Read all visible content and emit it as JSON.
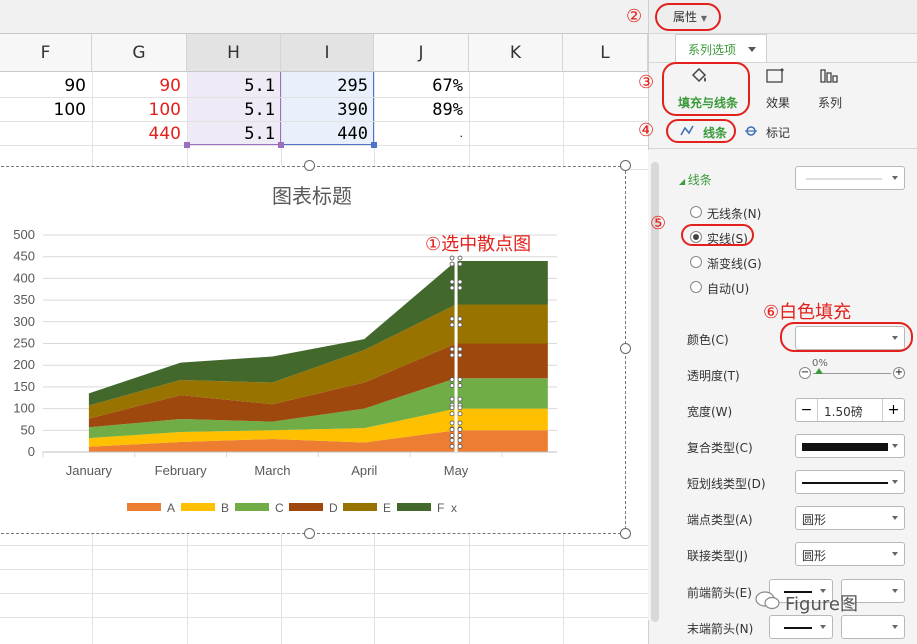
{
  "columns": [
    "F",
    "G",
    "H",
    "I",
    "J",
    "K",
    "L"
  ],
  "rows": [
    {
      "F": "90",
      "G": "90",
      "H": "5.1",
      "I": "295",
      "J": "67%"
    },
    {
      "F": "100",
      "G": "100",
      "H": "5.1",
      "I": "390",
      "J": "89%"
    },
    {
      "F": "",
      "G": "440",
      "H": "5.1",
      "I": "440",
      "J": "."
    }
  ],
  "chart_data": {
    "type": "area",
    "title": "图表标题",
    "x": [
      "January",
      "February",
      "March",
      "April",
      "May"
    ],
    "ylim": [
      0,
      500
    ],
    "yticks": [
      "500",
      "450",
      "400",
      "350",
      "300",
      "250",
      "200",
      "150",
      "100",
      "50",
      "0"
    ],
    "series": [
      {
        "name": "A",
        "color": "#ed7d31",
        "values": [
          12,
          23,
          30,
          22,
          50
        ]
      },
      {
        "name": "B",
        "color": "#ffc000",
        "values": [
          20,
          23,
          20,
          33,
          50
        ]
      },
      {
        "name": "C",
        "color": "#70ad47",
        "values": [
          25,
          30,
          20,
          45,
          70
        ]
      },
      {
        "name": "D",
        "color": "#9e480e",
        "values": [
          20,
          55,
          40,
          60,
          80
        ]
      },
      {
        "name": "E",
        "color": "#997300",
        "values": [
          30,
          35,
          50,
          75,
          90
        ]
      },
      {
        "name": "F",
        "color": "#43682b",
        "values": [
          28,
          40,
          60,
          25,
          100
        ]
      }
    ],
    "legend": [
      "A",
      "B",
      "C",
      "D",
      "E",
      "F",
      "x"
    ],
    "legend_position": "bottom",
    "grid": true
  },
  "annotations": {
    "a1": "①选中散点图",
    "a2": "②",
    "a3": "③",
    "a4": "④",
    "a5": "⑤",
    "a6": "⑥白色填充"
  },
  "panel": {
    "tab_label": "属性",
    "subtab_label": "系列选项",
    "cat_fill": "填充与线条",
    "cat_effect": "效果",
    "cat_series": "系列",
    "sub_line": "线条",
    "sub_marker": "标记",
    "section_line": "线条",
    "radio_none": "无线条(N)",
    "radio_solid": "实线(S)",
    "radio_gradient": "渐变线(G)",
    "radio_auto": "自动(U)",
    "color_label": "颜色(C)",
    "transparency_label": "透明度(T)",
    "transparency_value": "0%",
    "width_label": "宽度(W)",
    "width_value": "1.50磅",
    "compound_label": "复合类型(C)",
    "dash_label": "短划线类型(D)",
    "cap_label": "端点类型(A)",
    "cap_value": "圆形",
    "join_label": "联接类型(J)",
    "join_value": "圆形",
    "begin_arrow_label": "前端箭头(E)",
    "end_arrow_label": "末端箭头(N)",
    "watermark": "Figure图"
  }
}
